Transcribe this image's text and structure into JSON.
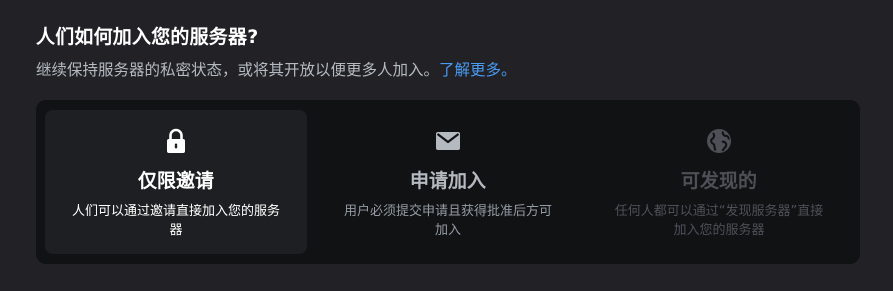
{
  "header": {
    "title": "人们如何加入您的服务器?",
    "subtitle": "继续保持服务器的私密状态，或将其开放以便更多人加入。",
    "learn_more": "了解更多。"
  },
  "options": [
    {
      "icon": "lock-icon",
      "title": "仅限邀请",
      "description": "人们可以通过邀请直接加入您的服务器",
      "state": "selected"
    },
    {
      "icon": "envelope-icon",
      "title": "申请加入",
      "description": "用户必须提交申请且获得批准后方可加入",
      "state": "enabled"
    },
    {
      "icon": "globe-icon",
      "title": "可发现的",
      "description": "任何人都可以通过“发现服务器”直接加入您的服务器",
      "state": "disabled"
    }
  ],
  "colors": {
    "background": "#212126",
    "panel": "#111214",
    "selected_card": "#1e1f22",
    "link": "#4a9bf2",
    "disabled": "#4e5058"
  }
}
